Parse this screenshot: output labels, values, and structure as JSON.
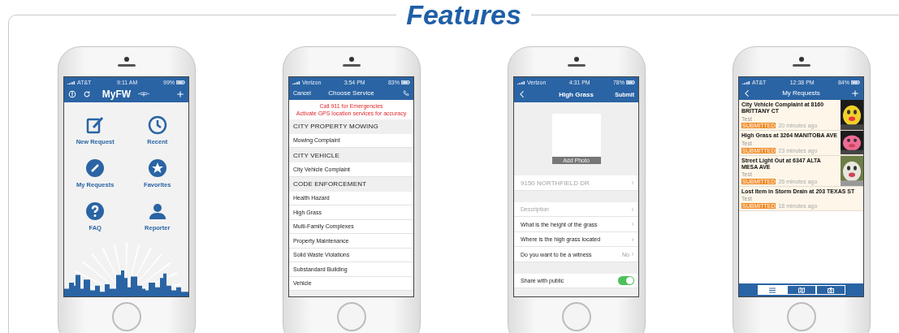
{
  "heading": "Features",
  "phones": [
    {
      "kind": "home",
      "status": {
        "carrier": "AT&T",
        "time": "9:11 AM",
        "battery": "99%"
      },
      "nav": {
        "title": "MyFW"
      },
      "tiles": [
        {
          "label": "New Request"
        },
        {
          "label": "Recent"
        },
        {
          "label": "My Requests"
        },
        {
          "label": "Favorites"
        },
        {
          "label": "FAQ"
        },
        {
          "label": "Reporter"
        }
      ]
    },
    {
      "kind": "services",
      "status": {
        "carrier": "Verizon",
        "time": "3:54 PM",
        "battery": "83%"
      },
      "nav": {
        "left": "Cancel",
        "title": "Choose Service"
      },
      "notices": [
        "Call 911 for Emergencies",
        "Activate GPS location services for accuracy"
      ],
      "rows": [
        {
          "kind": "header",
          "label": "CITY PROPERTY MOWING"
        },
        {
          "kind": "item",
          "label": "Mowing Complaint"
        },
        {
          "kind": "header",
          "label": "CITY VEHICLE"
        },
        {
          "kind": "item",
          "label": "City Vehicle Complaint"
        },
        {
          "kind": "header",
          "label": "CODE ENFORCEMENT"
        },
        {
          "kind": "item",
          "label": "Health Hazard"
        },
        {
          "kind": "item",
          "label": "High Grass"
        },
        {
          "kind": "item",
          "label": "Multi-Family Complexes"
        },
        {
          "kind": "item",
          "label": "Property Maintenance"
        },
        {
          "kind": "item",
          "label": "Solid Waste Violations"
        },
        {
          "kind": "item",
          "label": "Substandard Building"
        },
        {
          "kind": "item",
          "label": "Vehicle"
        }
      ]
    },
    {
      "kind": "form",
      "status": {
        "carrier": "Verizon",
        "time": "4:31 PM",
        "battery": "78%"
      },
      "nav": {
        "title": "High Grass",
        "right": "Submit"
      },
      "photo_label": "Add Photo",
      "address": "9150 NORTHFIELD DR",
      "fields": [
        {
          "label": "Description",
          "filled": false
        },
        {
          "label": "What is the height of the grass",
          "filled": true
        },
        {
          "label": "Where is the high grass located",
          "filled": true
        },
        {
          "label": "Do you want to be a witness",
          "filled": true,
          "value": "No"
        }
      ],
      "share": {
        "label": "Share with public",
        "on": true
      }
    },
    {
      "kind": "requests",
      "status": {
        "carrier": "AT&T",
        "time": "12:38 PM",
        "battery": "84%"
      },
      "nav": {
        "title": "My Requests"
      },
      "requests": [
        {
          "title": "City Vehicle Complaint at 8160 BRITTANY CT",
          "note": "Test",
          "status": "SUBMITTED",
          "time": "20 minutes ago"
        },
        {
          "title": "High Grass at 3264 MANITOBA AVE",
          "note": "Test",
          "status": "SUBMITTED",
          "time": "23 minutes ago"
        },
        {
          "title": "Street Light Out at 6347 ALTA MESA AVE",
          "note": "Test",
          "status": "SUBMITTED",
          "time": "26 minutes ago"
        },
        {
          "title": "Lost Item in Storm Drain at 203 TEXAS ST",
          "note": "Test",
          "status": "SUBMITTED",
          "time": "18 minutes ago"
        }
      ],
      "tabs": [
        {
          "selected": true
        },
        {
          "selected": false
        },
        {
          "selected": false
        }
      ]
    }
  ]
}
